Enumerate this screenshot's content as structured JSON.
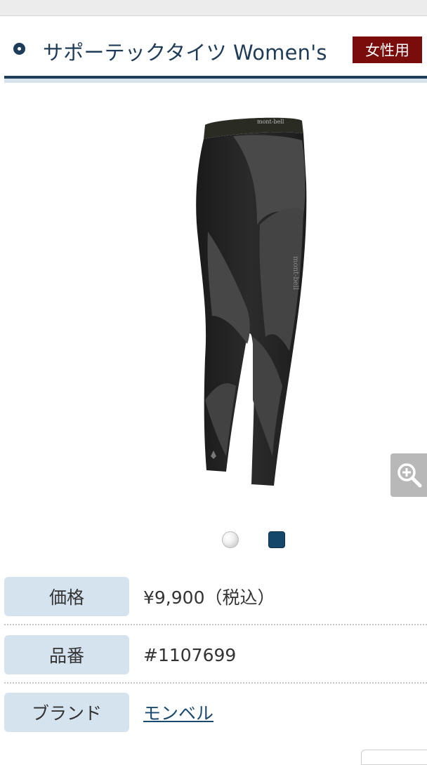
{
  "header": {
    "title": "サポーテックタイツ Women's",
    "badge": "女性用"
  },
  "product": {
    "image_icon": "tights-product-image",
    "waistband_brand": "mont-bell",
    "leg_brand": "mont-bell"
  },
  "zoom": {
    "icon": "zoom-in-icon"
  },
  "colors": {
    "swatches": [
      {
        "name": "white",
        "hex": "#f0f0f0"
      },
      {
        "name": "navy",
        "hex": "#15476b"
      }
    ]
  },
  "specs": [
    {
      "label": "価格",
      "value": "¥9,900（税込）"
    },
    {
      "label": "品番",
      "value": "#1107699"
    },
    {
      "label": "ブランド",
      "value": "モンベル"
    }
  ]
}
